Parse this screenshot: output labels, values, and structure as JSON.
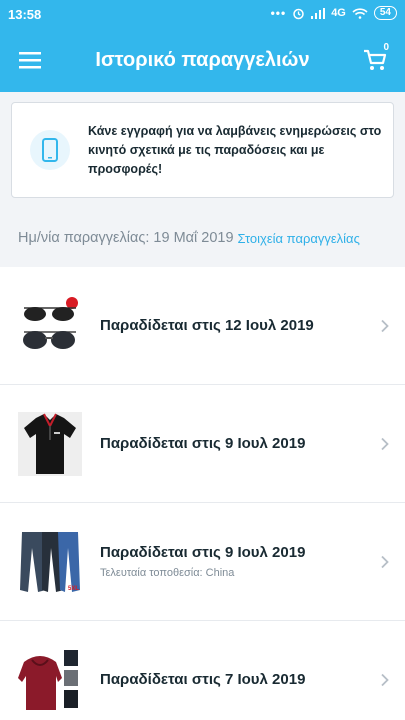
{
  "status": {
    "time": "13:58",
    "network": "4G",
    "battery": "54"
  },
  "header": {
    "title": "Ιστορικό παραγγελιών",
    "cart_count": "0"
  },
  "banner": {
    "text": "Κάνε εγγραφή για να λαμβάνεις ενημερώσεις στο κινητό σχετικά με τις παραδόσεις και με προσφορές!"
  },
  "order": {
    "date_label": "Ημ/νία παραγγελίας: 19 Μαΐ 2019",
    "details_link": "Στοιχεία παραγγελίας"
  },
  "items": [
    {
      "delivery": "Παραδίδεται στις 12 Ιουλ 2019",
      "location": "",
      "thumb_icon": "sunglasses-image"
    },
    {
      "delivery": "Παραδίδεται στις 9 Ιουλ 2019",
      "location": "",
      "thumb_icon": "polo-shirt-image"
    },
    {
      "delivery": "Παραδίδεται στις 9 Ιουλ 2019",
      "location": "Τελευταία τοποθεσία: China",
      "thumb_icon": "jeans-image"
    },
    {
      "delivery": "Παραδίδεται στις 7 Ιουλ 2019",
      "location": "",
      "thumb_icon": "hoodie-image"
    }
  ],
  "colors": {
    "accent": "#33b7ec",
    "link": "#2fb0e8",
    "text": "#192a32",
    "muted": "#7e8b96"
  }
}
